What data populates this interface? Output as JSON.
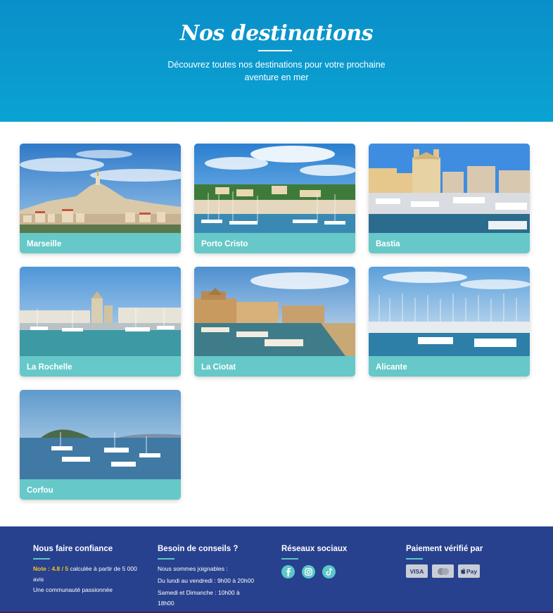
{
  "header": {
    "title": "Nos destinations",
    "subtitle": "Découvrez toutes nos destinations pour votre prochaine aventure en mer"
  },
  "destinations": [
    {
      "name": "Marseille",
      "scene": "city-hill"
    },
    {
      "name": "Porto Cristo",
      "scene": "marina-cliffs"
    },
    {
      "name": "Bastia",
      "scene": "church-harbor"
    },
    {
      "name": "La Rochelle",
      "scene": "old-port"
    },
    {
      "name": "La Ciotat",
      "scene": "stone-church-boats"
    },
    {
      "name": "Alicante",
      "scene": "marina-masts"
    },
    {
      "name": "Corfou",
      "scene": "bay-boats"
    }
  ],
  "footer": {
    "trust": {
      "title": "Nous faire confiance",
      "note_label": "Note : 4.8 / 5",
      "note_text": " calculée à partir de 5 000 avis",
      "community": "Une communauté passionnée"
    },
    "advice": {
      "title": "Besoin de conseils ?",
      "line1": "Nous sommes joignables :",
      "line2": "Du lundi au vendredi : 9h00 à 20h00",
      "line3": "Samedi et Dimanche : 10h00 à 18h00"
    },
    "social": {
      "title": "Réseaux sociaux",
      "icons": [
        "facebook-icon",
        "instagram-icon",
        "tiktok-icon"
      ]
    },
    "payment": {
      "title": "Paiement vérifié par",
      "methods": [
        "VISA",
        "mastercard",
        "Pay"
      ]
    }
  },
  "colors": {
    "hero": "#0a9ccf",
    "card_label_bg": "#66c8c8",
    "footer_bg": "#27418e",
    "accent": "#5bc7c7",
    "note": "#f5c518"
  }
}
